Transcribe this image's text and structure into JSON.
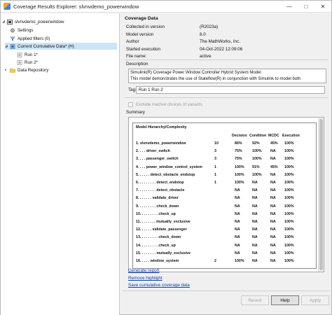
{
  "window": {
    "title": "Coverage Results Explorer: slvnvdemo_powerwindow"
  },
  "tree": {
    "root": "slvnvdemo_powerwindow",
    "settings": "Settings",
    "applied_filters": "Applied filters (0)",
    "current": "Current Cumulative Data* (H)",
    "run1": "Run 1*",
    "run2": "Run 2*",
    "repository": "Data Repository"
  },
  "coverage_data": {
    "heading": "Coverage Data",
    "rows": [
      {
        "k": "Collected in version",
        "v": "(R2023a)"
      },
      {
        "k": "Model version",
        "v": "8.0"
      },
      {
        "k": "Author",
        "v": "The MathWorks, Inc."
      },
      {
        "k": "Started execution",
        "v": "04-Oct-2022 12:09:06"
      },
      {
        "k": "File name:",
        "v": "active"
      }
    ]
  },
  "description": {
    "heading": "Description",
    "line1": "Simulink(R) Coverage Power Window Controller Hybrid System Model",
    "line2": "This model demonstrates the use of Stateflow(R) in conjunction with Simulink to model both"
  },
  "tag": {
    "label": "Tag:",
    "value": "Run 1 Run 2"
  },
  "exclude_label": "Exclude inactive choices of variants",
  "summary": {
    "heading": "Summary",
    "title": "Model Hierarchy/Complexity",
    "columns": [
      "Decision",
      "Condition",
      "MCDC",
      "Execution"
    ],
    "rows": [
      {
        "name": "1. slvnvdemo_powerwindow",
        "cx": "10",
        "d": "86%",
        "c": "92%",
        "m": "45%",
        "e": "100%"
      },
      {
        "name": "2. . . . driver_switch",
        "cx": "3",
        "d": "75%",
        "c": "100%",
        "m": "NA",
        "e": "100%"
      },
      {
        "name": "3. . . . passenger_switch",
        "cx": "3",
        "d": "75%",
        "c": "100%",
        "m": "NA",
        "e": "100%"
      },
      {
        "name": "4. . . . power_window_control_system",
        "cx": "1",
        "d": "100%",
        "c": "91%",
        "m": "45%",
        "e": "100%"
      },
      {
        "name": "5. . . . . . detect_obstacle_endstop",
        "cx": "1",
        "d": "100%",
        "c": "100%",
        "m": "NA",
        "e": "100%"
      },
      {
        "name": "6. . . . . . . . . detect_endstop",
        "cx": "1",
        "d": "100%",
        "c": "NA",
        "m": "NA",
        "e": "100%"
      },
      {
        "name": "7. . . . . . . . . detect_obstacle",
        "cx": "",
        "d": "NA",
        "c": "NA",
        "m": "NA",
        "e": "100%"
      },
      {
        "name": "8. . . . . . . validate_driver",
        "cx": "",
        "d": "NA",
        "c": "NA",
        "m": "NA",
        "e": "100%"
      },
      {
        "name": "9. . . . . . . . . check_down",
        "cx": "",
        "d": "NA",
        "c": "NA",
        "m": "NA",
        "e": "100%"
      },
      {
        "name": "10. . . . . . . . . check_up",
        "cx": "",
        "d": "NA",
        "c": "NA",
        "m": "NA",
        "e": "100%"
      },
      {
        "name": "11. . . . . . . . mutually_exclusive",
        "cx": "",
        "d": "NA",
        "c": "NA",
        "m": "NA",
        "e": "100%"
      },
      {
        "name": "12. . . . . . validate_passenger",
        "cx": "",
        "d": "NA",
        "c": "NA",
        "m": "NA",
        "e": "100%"
      },
      {
        "name": "13. . . . . . . . . check_down",
        "cx": "",
        "d": "NA",
        "c": "NA",
        "m": "NA",
        "e": "100%"
      },
      {
        "name": "14. . . . . . . . . check_up",
        "cx": "",
        "d": "NA",
        "c": "NA",
        "m": "NA",
        "e": "100%"
      },
      {
        "name": "15. . . . . . . . mutually_exclusive",
        "cx": "",
        "d": "NA",
        "c": "NA",
        "m": "NA",
        "e": "100%"
      },
      {
        "name": "16. . . . . window_system",
        "cx": "2",
        "d": "100%",
        "c": "NA",
        "m": "NA",
        "e": "100%"
      }
    ]
  },
  "links": [
    "Generate report",
    "Remove highlight",
    "Save cumulative coverage data"
  ],
  "buttons": {
    "revert": "Revert",
    "help": "Help",
    "apply": "Apply"
  }
}
